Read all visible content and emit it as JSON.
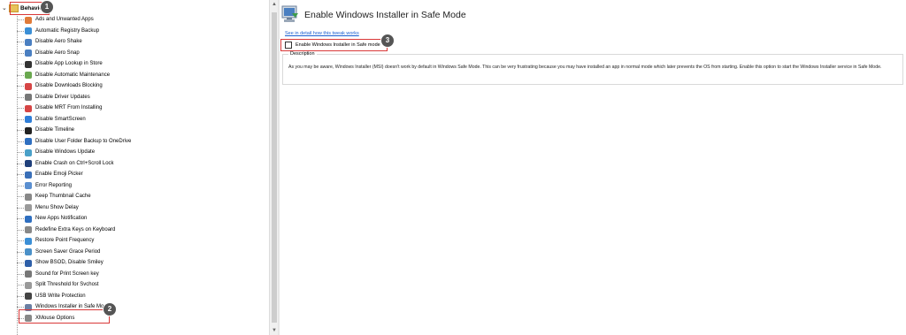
{
  "tree": {
    "root_label": "Behavior",
    "items": [
      {
        "label": "Ads and Unwanted Apps",
        "color": "#e07b39"
      },
      {
        "label": "Automatic Registry Backup",
        "color": "#3b8fd6"
      },
      {
        "label": "Disable Aero Shake",
        "color": "#4a7fc1"
      },
      {
        "label": "Disable Aero Snap",
        "color": "#4a7fc1"
      },
      {
        "label": "Disable App Lookup in Store",
        "color": "#333333"
      },
      {
        "label": "Disable Automatic Maintenance",
        "color": "#6aa84f"
      },
      {
        "label": "Disable Downloads Blocking",
        "color": "#d64545"
      },
      {
        "label": "Disable Driver Updates",
        "color": "#777777"
      },
      {
        "label": "Disable MRT From Installing",
        "color": "#d64545"
      },
      {
        "label": "Disable SmartScreen",
        "color": "#2f7ed8"
      },
      {
        "label": "Disable Timeline",
        "color": "#222222"
      },
      {
        "label": "Disable User Folder Backup to OneDrive",
        "color": "#2f6fc0"
      },
      {
        "label": "Disable Windows Update",
        "color": "#4aa0c8"
      },
      {
        "label": "Enable Crash on Ctrl+Scroll Lock",
        "color": "#1f3f7a"
      },
      {
        "label": "Enable Emoji Picker",
        "color": "#3a6fb8"
      },
      {
        "label": "Error Reporting",
        "color": "#5a8fd0"
      },
      {
        "label": "Keep Thumbnail Cache",
        "color": "#888888"
      },
      {
        "label": "Menu Show Delay",
        "color": "#9a9a9a"
      },
      {
        "label": "New Apps Notification",
        "color": "#2f6fc0"
      },
      {
        "label": "Redefine Extra Keys on Keyboard",
        "color": "#888888"
      },
      {
        "label": "Restore Point Frequency",
        "color": "#3b8fd6"
      },
      {
        "label": "Screen Saver Grace Period",
        "color": "#4a90c8"
      },
      {
        "label": "Show BSOD, Disable Smiley",
        "color": "#2e5fa8"
      },
      {
        "label": "Sound for Print Screen key",
        "color": "#777777"
      },
      {
        "label": "Split Threshold for Svchost",
        "color": "#999999"
      },
      {
        "label": "USB Write Protection",
        "color": "#444444"
      },
      {
        "label": "Windows Installer in Safe Mode",
        "color": "#6b7fa3"
      },
      {
        "label": "XMouse Options",
        "color": "#888888"
      }
    ],
    "selected_index": 26
  },
  "badges": {
    "one": "1",
    "two": "2",
    "three": "3"
  },
  "panel": {
    "title": "Enable Windows Installer in Safe Mode",
    "link": "See in detail how this tweak works",
    "checkbox_label": "Enable Windows Installer in Safe mode",
    "checkbox_checked": false,
    "description_heading": "Description",
    "description_text": "As you may be aware, Windows Installer (MSI) doesn't work by default in Windows Safe Mode. This can be very frustrating because you may have installed an app in normal mode which later prevents the OS from starting. Enable this option to start the Windows Installer service in Safe Mode."
  },
  "icons": {
    "collapse": "chevron-down-icon",
    "folder": "folder-icon",
    "header": "windows-installer-icon"
  },
  "colors": {
    "highlight": "#d93838",
    "badge": "#555555",
    "link": "#1a5fd1"
  }
}
